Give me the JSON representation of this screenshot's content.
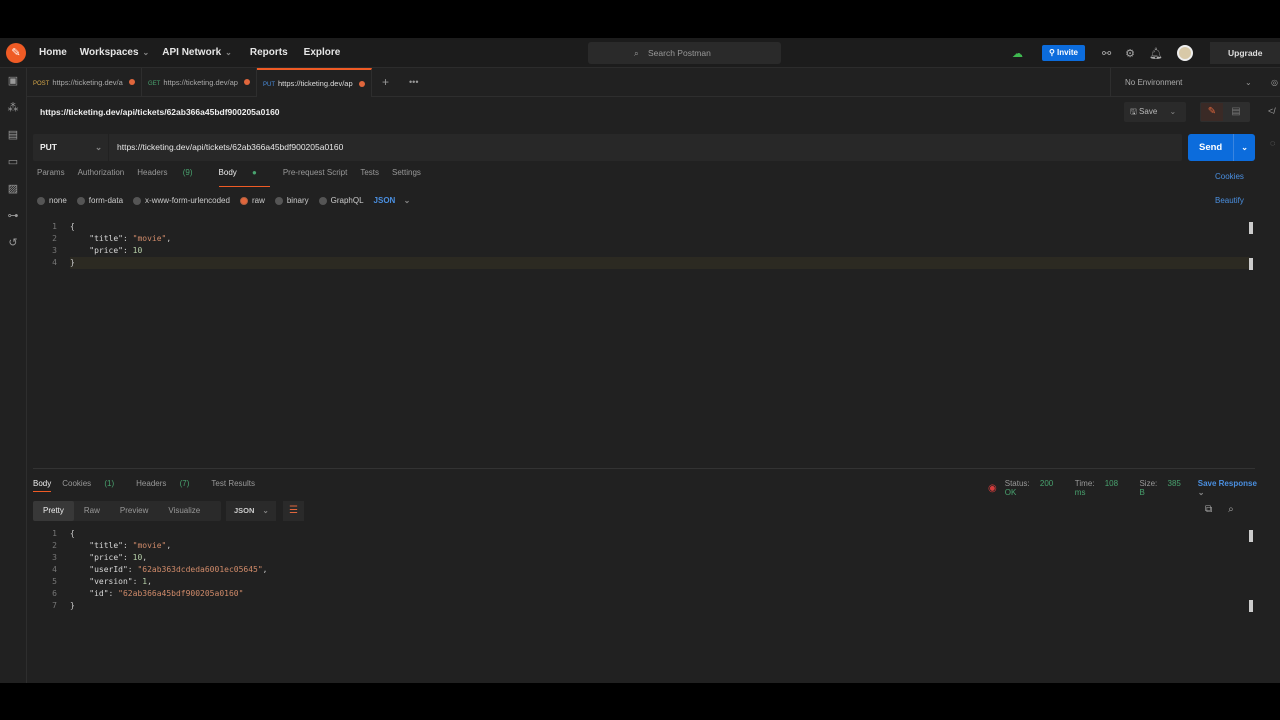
{
  "header": {
    "nav": [
      "Home",
      "Workspaces",
      "API Network",
      "Reports",
      "Explore"
    ],
    "search_placeholder": "Search Postman",
    "invite": "Invite",
    "upgrade": "Upgrade"
  },
  "tabs": [
    {
      "method": "POST",
      "method_color": "#d7a94a",
      "url": "https://ticketing.dev/a"
    },
    {
      "method": "GET",
      "method_color": "#49a36f",
      "url": "https://ticketing.dev/ap"
    },
    {
      "method": "PUT",
      "method_color": "#4a8fe0",
      "url": "https://ticketing.dev/ap"
    }
  ],
  "environment": "No Environment",
  "request": {
    "title": "https://ticketing.dev/api/tickets/62ab366a45bdf900205a0160",
    "method": "PUT",
    "url": "https://ticketing.dev/api/tickets/62ab366a45bdf900205a0160",
    "save": "Save",
    "send": "Send",
    "tabs": {
      "params": "Params",
      "authorization": "Authorization",
      "headers": "Headers",
      "headers_count": "(9)",
      "body": "Body",
      "prerequest": "Pre-request Script",
      "tests": "Tests",
      "settings": "Settings"
    },
    "cookies": "Cookies",
    "beautify": "Beautify",
    "body_types": [
      "none",
      "form-data",
      "x-www-form-urlencoded",
      "raw",
      "binary",
      "GraphQL"
    ],
    "selected_body_type": "raw",
    "format": "JSON",
    "body_lines": [
      [
        [
          "p",
          "{"
        ]
      ],
      [
        [
          "k",
          "    \"title\""
        ],
        [
          "p",
          ": "
        ],
        [
          "s",
          "\"movie\""
        ],
        [
          "p",
          ","
        ]
      ],
      [
        [
          "k",
          "    \"price\""
        ],
        [
          "p",
          ": "
        ],
        [
          "n",
          "10"
        ]
      ],
      [
        [
          "p",
          "}"
        ]
      ]
    ]
  },
  "response": {
    "tabs": {
      "body": "Body",
      "cookies": "Cookies",
      "cookies_count": "(1)",
      "headers": "Headers",
      "headers_count": "(7)",
      "tests": "Test Results"
    },
    "status_label": "Status:",
    "status": "200 OK",
    "time_label": "Time:",
    "time": "108 ms",
    "size_label": "Size:",
    "size": "385 B",
    "save_response": "Save Response",
    "views": [
      "Pretty",
      "Raw",
      "Preview",
      "Visualize"
    ],
    "format": "JSON",
    "body_lines": [
      [
        [
          "p",
          "{"
        ]
      ],
      [
        [
          "k",
          "    \"title\""
        ],
        [
          "p",
          ": "
        ],
        [
          "s",
          "\"movie\""
        ],
        [
          "p",
          ","
        ]
      ],
      [
        [
          "k",
          "    \"price\""
        ],
        [
          "p",
          ": "
        ],
        [
          "n",
          "10"
        ],
        [
          "p",
          ","
        ]
      ],
      [
        [
          "k",
          "    \"userId\""
        ],
        [
          "p",
          ": "
        ],
        [
          "s",
          "\"62ab363dcdeda6001ec05645\""
        ],
        [
          "p",
          ","
        ]
      ],
      [
        [
          "k",
          "    \"version\""
        ],
        [
          "p",
          ": "
        ],
        [
          "n",
          "1"
        ],
        [
          "p",
          ","
        ]
      ],
      [
        [
          "k",
          "    \"id\""
        ],
        [
          "p",
          ": "
        ],
        [
          "s",
          "\"62ab366a45bdf900205a0160\""
        ]
      ],
      [
        [
          "p",
          "}"
        ]
      ]
    ]
  }
}
